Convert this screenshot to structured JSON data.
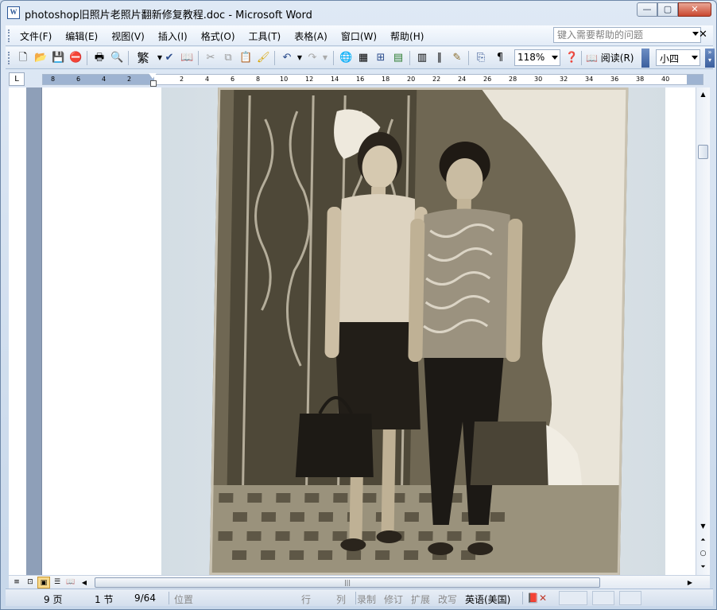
{
  "window": {
    "title": "photoshop旧照片老照片翻新修复教程.doc - Microsoft Word",
    "app_icon_label": "W",
    "min_label": "—",
    "max_label": "▢",
    "close_label": "✕"
  },
  "menu": {
    "items": [
      "文件(F)",
      "编辑(E)",
      "视图(V)",
      "插入(I)",
      "格式(O)",
      "工具(T)",
      "表格(A)",
      "窗口(W)",
      "帮助(H)"
    ],
    "help_placeholder": "键入需要帮助的问题",
    "doc_close_label": "✕"
  },
  "toolbar": {
    "zoom": "118%",
    "traditional_label": "繁",
    "read_label": "阅读(R)",
    "font_size": "小四"
  },
  "ruler": {
    "corner_label": "L",
    "numbers": [
      "8",
      "6",
      "4",
      "2",
      "2",
      "4",
      "6",
      "8",
      "10",
      "12",
      "14",
      "16",
      "18",
      "20",
      "22",
      "24",
      "26",
      "28",
      "30",
      "32",
      "34",
      "36",
      "38",
      "40"
    ]
  },
  "statusbar": {
    "page": "9 页",
    "section": "1 节",
    "page_of": "9/64",
    "position": "位置",
    "line": "行",
    "column": "列",
    "record": "录制",
    "revision": "修订",
    "extend": "扩展",
    "overwrite": "改写",
    "language": "英语(美国)"
  },
  "icons": {
    "new": "new-document-icon",
    "open": "open-folder-icon",
    "save": "save-disk-icon",
    "permission": "permission-icon",
    "print": "print-icon",
    "preview": "print-preview-icon",
    "spelling": "spelling-icon",
    "research": "research-icon",
    "cut": "cut-icon",
    "copy": "copy-icon",
    "paste": "paste-icon",
    "format_painter": "format-painter-icon",
    "undo": "undo-icon",
    "redo": "redo-icon",
    "hyperlink": "hyperlink-icon",
    "tables_borders": "tables-borders-icon",
    "insert_table": "insert-table-icon",
    "insert_excel": "insert-excel-icon",
    "columns": "columns-icon",
    "drawing": "drawing-icon",
    "document_map": "document-map-icon",
    "show_hide": "show-hide-icon",
    "help": "help-icon"
  }
}
